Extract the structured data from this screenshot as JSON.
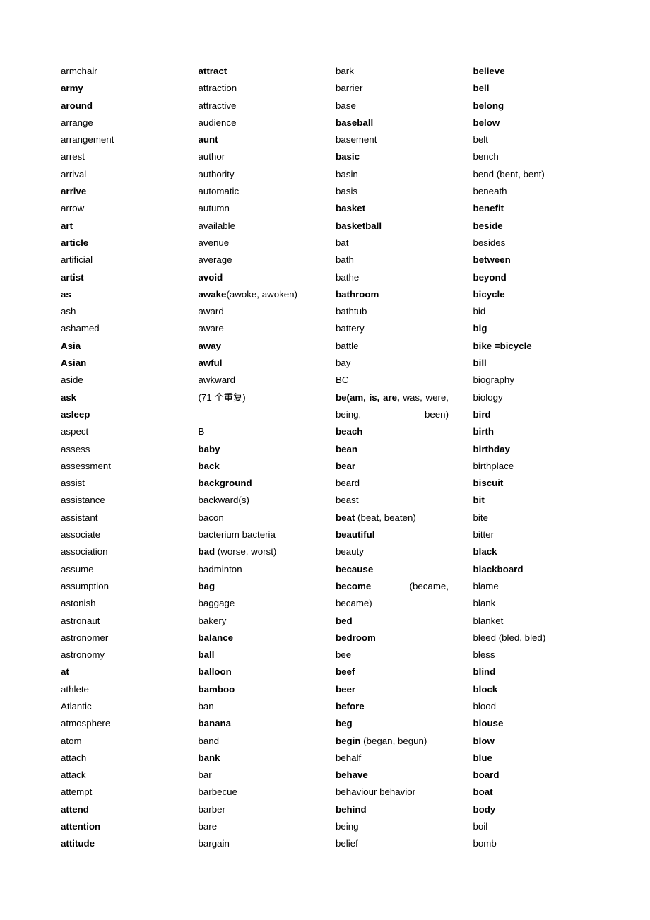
{
  "document": {
    "type": "vocabulary-word-list",
    "section_marker": "B",
    "note": "(71 个重复)"
  },
  "columns": [
    {
      "name": "column-1",
      "entries": [
        {
          "text": "armchair",
          "bold": false
        },
        {
          "text": "army",
          "bold": true
        },
        {
          "text": "around",
          "bold": true
        },
        {
          "text": "arrange",
          "bold": false
        },
        {
          "text": "arrangement",
          "bold": false
        },
        {
          "text": "arrest",
          "bold": false
        },
        {
          "text": "arrival",
          "bold": false
        },
        {
          "text": "arrive",
          "bold": true
        },
        {
          "text": "arrow",
          "bold": false
        },
        {
          "text": "art",
          "bold": true
        },
        {
          "text": "article",
          "bold": true
        },
        {
          "text": "artificial",
          "bold": false
        },
        {
          "text": "artist",
          "bold": true
        },
        {
          "text": "as",
          "bold": true
        },
        {
          "text": "ash",
          "bold": false
        },
        {
          "text": "ashamed",
          "bold": false
        },
        {
          "text": "Asia",
          "bold": true
        },
        {
          "text": "Asian",
          "bold": true
        },
        {
          "text": "aside",
          "bold": false
        },
        {
          "text": "ask",
          "bold": true
        },
        {
          "text": "asleep",
          "bold": true
        },
        {
          "text": "aspect",
          "bold": false
        },
        {
          "text": "assess",
          "bold": false
        },
        {
          "text": "assessment",
          "bold": false
        },
        {
          "text": "assist",
          "bold": false
        },
        {
          "text": "assistance",
          "bold": false
        },
        {
          "text": "assistant",
          "bold": false
        },
        {
          "text": "associate",
          "bold": false
        },
        {
          "text": "association",
          "bold": false
        },
        {
          "text": "assume",
          "bold": false
        },
        {
          "text": "assumption",
          "bold": false
        },
        {
          "text": "astonish",
          "bold": false
        },
        {
          "text": "astronaut",
          "bold": false
        },
        {
          "text": "astronomer",
          "bold": false
        },
        {
          "text": "astronomy",
          "bold": false
        },
        {
          "text": "at",
          "bold": true
        },
        {
          "text": "athlete",
          "bold": false
        },
        {
          "text": "Atlantic",
          "bold": false
        },
        {
          "text": "atmosphere",
          "bold": false
        },
        {
          "text": "atom",
          "bold": false
        },
        {
          "text": "attach",
          "bold": false
        },
        {
          "text": "attack",
          "bold": false
        },
        {
          "text": "attempt",
          "bold": false
        },
        {
          "text": "attend",
          "bold": true
        },
        {
          "text": "attention",
          "bold": true
        },
        {
          "text": "attitude",
          "bold": true
        }
      ]
    },
    {
      "name": "column-2",
      "entries": [
        {
          "text": "attract",
          "bold": true
        },
        {
          "text": "attraction",
          "bold": false
        },
        {
          "text": "attractive",
          "bold": false
        },
        {
          "text": "audience",
          "bold": false
        },
        {
          "text": "aunt",
          "bold": true
        },
        {
          "text": "author",
          "bold": false
        },
        {
          "text": "authority",
          "bold": false
        },
        {
          "text": "automatic",
          "bold": false
        },
        {
          "text": "autumn",
          "bold": false
        },
        {
          "text": "available",
          "bold": false
        },
        {
          "text": "avenue",
          "bold": false
        },
        {
          "text": "average",
          "bold": false
        },
        {
          "text": "avoid",
          "bold": true
        },
        {
          "head": "awake",
          "rest": "(awoke, awoken)",
          "bold": false
        },
        {
          "text": "award",
          "bold": false
        },
        {
          "text": "aware",
          "bold": false
        },
        {
          "text": "away",
          "bold": true
        },
        {
          "text": "awful",
          "bold": true
        },
        {
          "text": "awkward",
          "bold": false
        },
        {
          "text": "(71 个重复)",
          "bold": false
        },
        {
          "text": "",
          "bold": false,
          "blank": true
        },
        {
          "text": "B",
          "bold": false
        },
        {
          "text": "baby",
          "bold": true
        },
        {
          "text": "back",
          "bold": true
        },
        {
          "text": "background",
          "bold": true
        },
        {
          "text": "backward(s)",
          "bold": false
        },
        {
          "text": "bacon",
          "bold": false
        },
        {
          "text": "bacterium bacteria",
          "bold": false
        },
        {
          "head": "bad",
          "rest": " (worse, worst)",
          "bold": false
        },
        {
          "text": "badminton",
          "bold": false
        },
        {
          "text": "bag",
          "bold": true
        },
        {
          "text": "baggage",
          "bold": false
        },
        {
          "text": "bakery",
          "bold": false
        },
        {
          "text": "balance",
          "bold": true
        },
        {
          "text": "ball",
          "bold": true
        },
        {
          "text": "balloon",
          "bold": true
        },
        {
          "text": "bamboo",
          "bold": true
        },
        {
          "text": "ban",
          "bold": false
        },
        {
          "text": "banana",
          "bold": true
        },
        {
          "text": "band",
          "bold": false
        },
        {
          "text": "bank",
          "bold": true
        },
        {
          "text": "bar",
          "bold": false
        },
        {
          "text": "barbecue",
          "bold": false
        },
        {
          "text": "barber",
          "bold": false
        },
        {
          "text": "bare",
          "bold": false
        },
        {
          "text": "bargain",
          "bold": false
        }
      ]
    },
    {
      "name": "column-3",
      "entries": [
        {
          "text": "bark",
          "bold": false
        },
        {
          "text": "barrier",
          "bold": false
        },
        {
          "text": "base",
          "bold": false
        },
        {
          "text": "baseball",
          "bold": true
        },
        {
          "text": "basement",
          "bold": false
        },
        {
          "text": "basic",
          "bold": true
        },
        {
          "text": "basin",
          "bold": false
        },
        {
          "text": "basis",
          "bold": false
        },
        {
          "text": "basket",
          "bold": true
        },
        {
          "text": "basketball",
          "bold": true
        },
        {
          "text": "bat",
          "bold": false
        },
        {
          "text": "bath",
          "bold": false
        },
        {
          "text": "bathe",
          "bold": false
        },
        {
          "text": "bathroom",
          "bold": true
        },
        {
          "text": "bathtub",
          "bold": false
        },
        {
          "text": "battery",
          "bold": false
        },
        {
          "text": "battle",
          "bold": false
        },
        {
          "text": "bay",
          "bold": false
        },
        {
          "text": "BC",
          "bold": false
        },
        {
          "head": "be(am,  is,  are,",
          "rest": " was, were, being, been)",
          "bold": false,
          "justify": true
        },
        {
          "text": "beach",
          "bold": true
        },
        {
          "text": "bean",
          "bold": true
        },
        {
          "text": "bear",
          "bold": true
        },
        {
          "text": "beard",
          "bold": false
        },
        {
          "text": "beast",
          "bold": false
        },
        {
          "head": "beat",
          "rest": " (beat, beaten)",
          "bold": false
        },
        {
          "text": "beautiful",
          "bold": true
        },
        {
          "text": "beauty",
          "bold": false
        },
        {
          "text": "because",
          "bold": true
        },
        {
          "head": "become",
          "rest": " (became, became)",
          "bold": false,
          "justify": true
        },
        {
          "text": "bed",
          "bold": true
        },
        {
          "text": "bedroom",
          "bold": true
        },
        {
          "text": "bee",
          "bold": false
        },
        {
          "text": "beef",
          "bold": true
        },
        {
          "text": "beer",
          "bold": true
        },
        {
          "text": "before",
          "bold": true
        },
        {
          "text": "beg",
          "bold": true
        },
        {
          "head": "begin",
          "rest": " (began, begun)",
          "bold": false
        },
        {
          "text": "behalf",
          "bold": false
        },
        {
          "text": "behave",
          "bold": true
        },
        {
          "text": "behaviour behavior",
          "bold": false
        },
        {
          "text": "behind",
          "bold": true
        },
        {
          "text": "being",
          "bold": false
        },
        {
          "text": "belief",
          "bold": false
        }
      ]
    },
    {
      "name": "column-4",
      "entries": [
        {
          "text": "believe",
          "bold": true
        },
        {
          "text": "bell",
          "bold": true
        },
        {
          "text": "belong",
          "bold": true
        },
        {
          "text": "below",
          "bold": true
        },
        {
          "text": "belt",
          "bold": false
        },
        {
          "text": "bench",
          "bold": false
        },
        {
          "text": "bend (bent, bent)",
          "bold": false
        },
        {
          "text": "beneath",
          "bold": false
        },
        {
          "text": "benefit",
          "bold": true
        },
        {
          "text": "beside",
          "bold": true
        },
        {
          "text": "besides",
          "bold": false
        },
        {
          "text": "between",
          "bold": true
        },
        {
          "text": "beyond",
          "bold": true
        },
        {
          "text": "bicycle",
          "bold": true
        },
        {
          "text": "bid",
          "bold": false
        },
        {
          "text": "big",
          "bold": true
        },
        {
          "text": "bike =bicycle",
          "bold": true
        },
        {
          "text": "bill",
          "bold": true
        },
        {
          "text": "biography",
          "bold": false
        },
        {
          "text": "biology",
          "bold": false
        },
        {
          "text": "bird",
          "bold": true
        },
        {
          "text": "birth",
          "bold": true
        },
        {
          "text": "birthday",
          "bold": true
        },
        {
          "text": "birthplace",
          "bold": false
        },
        {
          "text": "biscuit",
          "bold": true
        },
        {
          "text": "bit",
          "bold": true
        },
        {
          "text": "bite",
          "bold": false
        },
        {
          "text": "bitter",
          "bold": false
        },
        {
          "text": "black",
          "bold": true
        },
        {
          "text": "blackboard",
          "bold": true
        },
        {
          "text": "blame",
          "bold": false
        },
        {
          "text": "blank",
          "bold": false
        },
        {
          "text": "blanket",
          "bold": false
        },
        {
          "text": "bleed (bled, bled)",
          "bold": false
        },
        {
          "text": "bless",
          "bold": false
        },
        {
          "text": "blind",
          "bold": true
        },
        {
          "text": "block",
          "bold": true
        },
        {
          "text": "blood",
          "bold": false
        },
        {
          "text": "blouse",
          "bold": true
        },
        {
          "text": "blow",
          "bold": true
        },
        {
          "text": "blue",
          "bold": true
        },
        {
          "text": "board",
          "bold": true
        },
        {
          "text": "boat",
          "bold": true
        },
        {
          "text": "body",
          "bold": true
        },
        {
          "text": "boil",
          "bold": false
        },
        {
          "text": "bomb",
          "bold": false
        }
      ]
    }
  ]
}
